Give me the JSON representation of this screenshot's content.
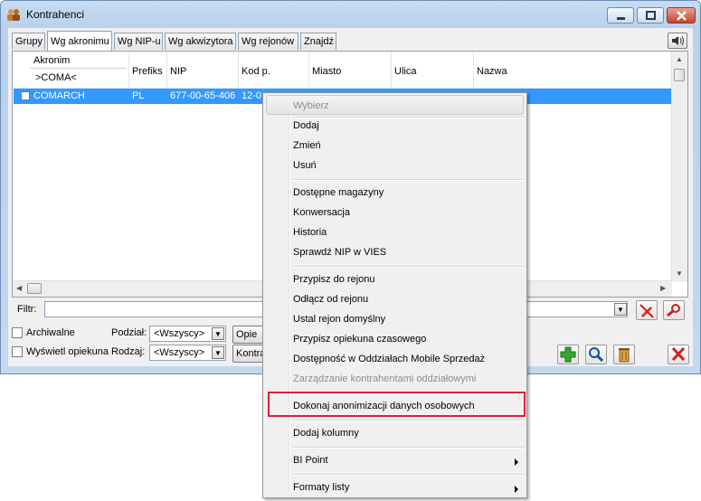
{
  "window": {
    "title": "Kontrahenci"
  },
  "tabs": [
    {
      "label": "Grupy"
    },
    {
      "label": "Wg akronimu"
    },
    {
      "label": "Wg NIP-u"
    },
    {
      "label": "Wg akwizytora"
    },
    {
      "label": "Wg rejonów"
    },
    {
      "label": "Znajdź"
    }
  ],
  "active_tab": "Wg akronimu",
  "list": {
    "headers": {
      "akronim": "Akronim",
      "akronim_filter": ">COMA<",
      "prefiks": "Prefiks",
      "nip": "NIP",
      "kod": "Kod p.",
      "miasto": "Miasto",
      "ulica": "Ulica",
      "nazwa": "Nazwa"
    },
    "rows": [
      {
        "akronim": "COMARCH",
        "prefiks": "PL",
        "nip": "677-00-65-406",
        "kod": "12-0"
      }
    ]
  },
  "filter": {
    "label": "Filtr:",
    "value": ""
  },
  "options": {
    "archiwalne": "Archiwalne",
    "opiekuna": "Wyświetl opiekuna",
    "podzial_label": "Podział:",
    "podzial_value": "<Wszyscy>",
    "rodzaj_label": "Rodzaj:",
    "rodzaj_value": "<Wszyscy>",
    "btn1": "Opie",
    "btn2": "Kontra"
  },
  "context_menu": {
    "items": [
      {
        "label": "Wybierz",
        "disabled": true
      },
      {
        "label": "Dodaj"
      },
      {
        "label": "Zmień"
      },
      {
        "label": "Usuń"
      },
      {
        "label": "Dostępne magazyny"
      },
      {
        "label": "Konwersacja"
      },
      {
        "label": "Historia"
      },
      {
        "label": "Sprawdź NIP w VIES"
      },
      {
        "label": "Przypisz do rejonu"
      },
      {
        "label": "Odłącz od rejonu"
      },
      {
        "label": "Ustal rejon domyślny"
      },
      {
        "label": "Przypisz opiekuna czasowego"
      },
      {
        "label": "Dostępność w Oddziałach Mobile Sprzedaż"
      },
      {
        "label": "Zarządzanie kontrahentami oddziałowymi",
        "disabled": true
      },
      {
        "label": "Dokonaj anonimizacji danych osobowych",
        "highlighted_box": true
      },
      {
        "label": "Dodaj kolumny"
      },
      {
        "label": "BI Point",
        "submenu": true
      },
      {
        "label": "Formaty listy",
        "submenu": true
      }
    ]
  },
  "colors": {
    "selection": "#3399ff",
    "highlight_box": "#e0202e"
  }
}
